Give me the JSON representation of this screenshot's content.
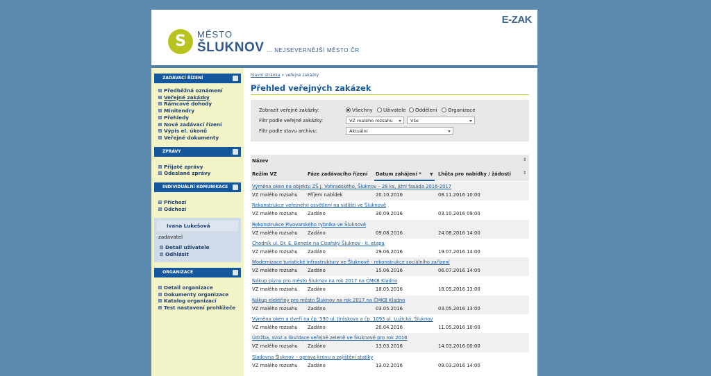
{
  "header": {
    "logo_letter": "S",
    "city_prefix": "MĚSTO",
    "city_name": "ŠLUKNOV",
    "slogan": "... NEJSEVERNĚJŠÍ MĚSTO ČR",
    "brand": "E-ZAK"
  },
  "sidebar": {
    "sections": [
      {
        "title": "ZADÁVACÍ ŘÍZENÍ",
        "items": [
          "Předběžná oznámení",
          "Veřejné zakázky",
          "Rámcové dohody",
          "Minitendry",
          "Přehledy",
          "Nové zadávací řízení",
          "Výpis el. úkonů",
          "Veřejné dokumenty"
        ]
      },
      {
        "title": "ZPRÁVY",
        "items": [
          "Přijaté zprávy",
          "Odeslané zprávy"
        ]
      },
      {
        "title": "INDIVIDUÁLNÍ KOMUNIKACE",
        "items": [
          "Příchozí",
          "Odchozí"
        ]
      },
      {
        "title": "ORGANIZACE",
        "items": [
          "Detail organizace",
          "Dokumenty organizace",
          "Katalog organizací",
          "Test nastavení prohlížeče"
        ]
      }
    ],
    "user": {
      "name": "Ivana Lukešová",
      "role": "zadavatel",
      "links": [
        "Detail uživatele",
        "Odhlásit"
      ]
    }
  },
  "content": {
    "breadcrumb_home": "hlavní stránka",
    "breadcrumb_sep": "»",
    "breadcrumb_current": "veřejné zakázky",
    "title": "Přehled veřejných zakázek",
    "filter": {
      "show_label": "Zobrazit veřejné zakázky:",
      "radio_options": [
        "Všechny",
        "Uživatele",
        "Oddělení",
        "Organizace"
      ],
      "radio_selected": "Všechny",
      "type_label": "Filtr podle veřejné zakázky:",
      "type_value": "VZ malého rozsahu",
      "phase_value": "Vše",
      "archive_label": "Filtr podle stavu archivu:",
      "archive_value": "Aktuální"
    },
    "table": {
      "col_name": "Název",
      "col_mode": "Režim VZ",
      "col_phase": "Fáze zadávacího řízení",
      "col_date": "Datum zahájení *",
      "col_deadline": "Lhůta pro nabídky / žádosti",
      "rows": [
        {
          "title": "Výměna oken na objektu ZŠ J. Vohradského, Šluknov – 28 ks, jižní fasáda 2016-2017",
          "mode": "VZ malého rozsahu",
          "phase": "Příjem nabídek",
          "date": "20.10.2016",
          "deadline": "08.11.2016 10:00"
        },
        {
          "title": "Rekonstrukce veřejného osvětlení na sídlišti ve Šluknově",
          "mode": "VZ malého rozsahu",
          "phase": "Zadáno",
          "date": "30.09.2016",
          "deadline": "03.10.2016 09:00"
        },
        {
          "title": "Rekonstrukce Pivovarského rybníka ve Šluknově",
          "mode": "VZ malého rozsahu",
          "phase": "Zadáno",
          "date": "09.08.2016",
          "deadline": "24.08.2016 14:00"
        },
        {
          "title": "Chodník ul. Dr. E. Beneše na Císařský Šluknov - II. etapa",
          "mode": "VZ malého rozsahu",
          "phase": "Zadáno",
          "date": "29.06.2016",
          "deadline": "19.07.2016 14:00"
        },
        {
          "title": "Modernizace turistické infrastruktury ve Šluknově - rekonstrukce sociálního zařízení",
          "mode": "VZ malého rozsahu",
          "phase": "Zadáno",
          "date": "15.06.2016",
          "deadline": "06.07.2016 14:00"
        },
        {
          "title": "Nákup plynu pro město Šluknov na rok 2017 na ČMKB Kladno",
          "mode": "VZ malého rozsahu",
          "phase": "Zadáno",
          "date": "18.05.2016",
          "deadline": "18.05.2016 13:00"
        },
        {
          "title": "Nákup elektřiny pro město Šluknov na rok 2017 na ČMKB Kladno",
          "mode": "VZ malého rozsahu",
          "phase": "Zadáno",
          "date": "03.05.2016",
          "deadline": "03.05.2016 13:00"
        },
        {
          "title": "Výměna oken a dveří na čp. 590 ul. Jiráskova a čp. 1093 ul. Lužická, Šluknov",
          "mode": "VZ malého rozsahu",
          "phase": "Zadáno",
          "date": "20.04.2016",
          "deadline": "11.05.2016 10:00"
        },
        {
          "title": "Údržba, svoz a likvidace veřejné zeleně ve Šluknově pro rok 2016",
          "mode": "VZ malého rozsahu",
          "phase": "Zadáno",
          "date": "13.03.2016",
          "deadline": "14.03.2016 00:00"
        },
        {
          "title": "Sladovna Šluknov – oprava krovu a zajištění statiky",
          "mode": "VZ malého rozsahu",
          "phase": "Zadáno",
          "date": "13.02.2016",
          "deadline": "09.03.2016 14:00"
        }
      ]
    }
  }
}
